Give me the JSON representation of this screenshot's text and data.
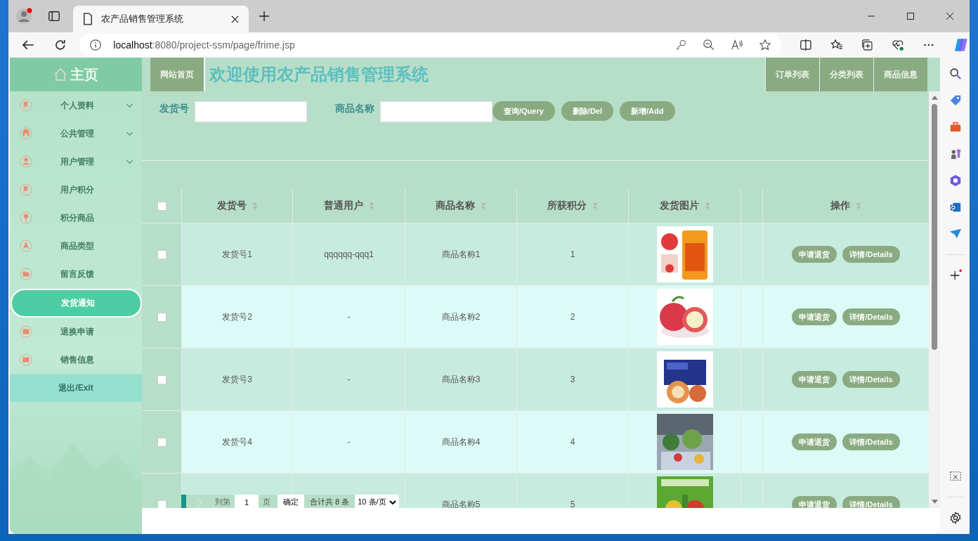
{
  "browser": {
    "tab_title": "农产品销售管理系统",
    "url_host": "localhost",
    "url_rest": ":8080/project-ssm/page/frime.jsp"
  },
  "sidebar": {
    "home": "主页",
    "items": [
      {
        "label": "个人资料",
        "has_submenu": true,
        "selected": false
      },
      {
        "label": "公共管理",
        "has_submenu": true,
        "selected": false
      },
      {
        "label": "用户管理",
        "has_submenu": true,
        "selected": false
      },
      {
        "label": "用户积分",
        "has_submenu": false,
        "selected": false
      },
      {
        "label": "积分商品",
        "has_submenu": false,
        "selected": false
      },
      {
        "label": "商品类型",
        "has_submenu": false,
        "selected": false
      },
      {
        "label": "留言反馈",
        "has_submenu": false,
        "selected": false
      },
      {
        "label": "发货通知",
        "has_submenu": false,
        "selected": true
      },
      {
        "label": "退换申请",
        "has_submenu": false,
        "selected": false
      },
      {
        "label": "销售信息",
        "has_submenu": false,
        "selected": false
      }
    ],
    "exit": "退出/Exit"
  },
  "topbar": {
    "home_link": "网站首页",
    "title": "欢迎使用农产品销售管理系统",
    "nav": [
      "订单列表",
      "分类列表",
      "商品信息"
    ]
  },
  "search": {
    "fields": [
      {
        "label": "发货号"
      },
      {
        "label": "商品名称"
      }
    ],
    "buttons": [
      "查询/Query",
      "删除/Del",
      "新增/Add"
    ]
  },
  "table": {
    "all_checked": false,
    "columns": [
      {
        "label": "发货号",
        "sortable": true
      },
      {
        "label": "普通用户",
        "sortable": true
      },
      {
        "label": "商品名称",
        "sortable": true
      },
      {
        "label": "所获积分",
        "sortable": true
      },
      {
        "label": "发货图片",
        "sortable": true
      },
      {
        "label": "操作",
        "sortable": true
      }
    ],
    "rows": [
      {
        "checked": false,
        "id": "发货号1",
        "user": "qqqqqq-qqq1",
        "product": "商品名称1",
        "points": "1",
        "picture": {
          "kind": "picture"
        },
        "actions": [
          "申请退货",
          "详情/Details"
        ]
      },
      {
        "checked": false,
        "id": "发货号2",
        "user": "-",
        "product": "商品名称2",
        "points": "2",
        "picture": {
          "kind": "picture"
        },
        "actions": [
          "申请退货",
          "详情/Details"
        ]
      },
      {
        "checked": false,
        "id": "发货号3",
        "user": "-",
        "product": "商品名称3",
        "points": "3",
        "picture": {
          "kind": "picture"
        },
        "actions": [
          "申请退货",
          "详情/Details"
        ]
      },
      {
        "checked": false,
        "id": "发货号4",
        "user": "-",
        "product": "商品名称4",
        "points": "4",
        "picture": {
          "kind": "picture"
        },
        "actions": [
          "申请退货",
          "详情/Details"
        ]
      },
      {
        "checked": false,
        "product": "商品名称5",
        "points": "5",
        "picture": {
          "kind": "picture"
        },
        "actions": [
          "申请退货",
          "详情/Details"
        ]
      }
    ]
  },
  "pagination": {
    "goto_label": "到第",
    "page": "1",
    "page_suffix": "页",
    "confirm": "确定",
    "total": "合计共 8 条",
    "page_size": "10 条/页"
  }
}
